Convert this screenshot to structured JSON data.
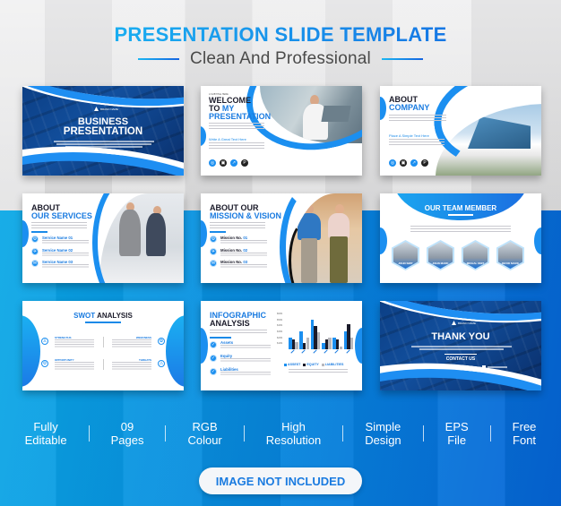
{
  "header": {
    "title": "PRESENTATION SLIDE TEMPLATE",
    "subtitle": "Clean And Professional"
  },
  "colors": {
    "accent_blue": "#1a7be0",
    "accent_cyan": "#1bc0f5",
    "dark_text": "#1b1b2a"
  },
  "slides": {
    "business": {
      "title_line1": "BUSINESS",
      "title_line2": "PRESENTATION",
      "logo_text": "BRAND NAME"
    },
    "welcome": {
      "kicker": "A SUBTITLE HERE",
      "line1": "WELCOME",
      "line2a": "TO ",
      "line2b": "MY",
      "line3": "PRESENTATION",
      "sub": "Write A Great Text Here",
      "social_icons": [
        "dribbble-icon",
        "instagram-icon",
        "chart-icon",
        "pinterest-icon"
      ]
    },
    "about_company": {
      "line1": "ABOUT",
      "line2": "COMPANY",
      "sub": "Place A Simple Text Here"
    },
    "services": {
      "line1": "ABOUT",
      "line2": "OUR SERVICES",
      "items": [
        {
          "label": "Service Name ",
          "num": "01"
        },
        {
          "label": "Service Name ",
          "num": "02"
        },
        {
          "label": "Service Name ",
          "num": "03"
        }
      ]
    },
    "mission": {
      "line1": "ABOUT OUR",
      "line2": "MISSION & VISION",
      "items": [
        {
          "label": "Mission No. ",
          "num": "01"
        },
        {
          "label": "Mission No. ",
          "num": "02"
        },
        {
          "label": "Mission No. ",
          "num": "03"
        }
      ]
    },
    "team": {
      "title": "OUR TEAM MEMBER",
      "members": [
        "JOHN SMIT",
        "JOHN MARK",
        "MICHAL SMIT",
        "DEVID MARK"
      ]
    },
    "swot": {
      "title_blue": "SWOT",
      "title_dark": " ANALYSIS",
      "left": [
        "STRENGTHS",
        "OPPORTUNITY"
      ],
      "right": [
        "WEEKNESS",
        "THREATS"
      ]
    },
    "infographic": {
      "line1": "INFOGRAPHIC",
      "line2": "ANALYSIS",
      "items": [
        "Assets",
        "Equity",
        "Liabilities"
      ],
      "legend": [
        "ASSEST",
        "EQUITY",
        "LIABILITIES"
      ]
    },
    "thankyou": {
      "title": "THANK YOU",
      "contact": "CONTACT US",
      "logo_text": "BRAND NAME"
    }
  },
  "chart_data": {
    "type": "bar",
    "title": "",
    "xlabel": "",
    "ylabel": "",
    "categories": [
      "",
      "",
      "",
      "",
      "",
      ""
    ],
    "yticks": [
      "$60M",
      "$50M",
      "$40M",
      "$30M",
      "$20M",
      "$10M"
    ],
    "ylim": [
      0,
      60
    ],
    "series": [
      {
        "name": "ASSEST",
        "color": "#1b8ff0",
        "values": [
          20,
          30,
          50,
          10,
          19,
          30
        ]
      },
      {
        "name": "EQUITY",
        "color": "#1b1b2a",
        "values": [
          16,
          10,
          39,
          16,
          16,
          42
        ]
      },
      {
        "name": "LIABILITIES",
        "color": "#b8b8bd",
        "values": [
          12,
          20,
          29,
          20,
          5,
          20
        ]
      }
    ],
    "legend_position": "bottom"
  },
  "features": [
    {
      "line1": "Fully",
      "line2": "Editable"
    },
    {
      "line1": "09",
      "line2": "Pages"
    },
    {
      "line1": "RGB",
      "line2": "Colour"
    },
    {
      "line1": "High",
      "line2": "Resolution"
    },
    {
      "line1": "Simple",
      "line2": "Design"
    },
    {
      "line1": "EPS",
      "line2": "File"
    },
    {
      "line1": "Free",
      "line2": "Font"
    }
  ],
  "badge": "IMAGE NOT INCLUDED"
}
